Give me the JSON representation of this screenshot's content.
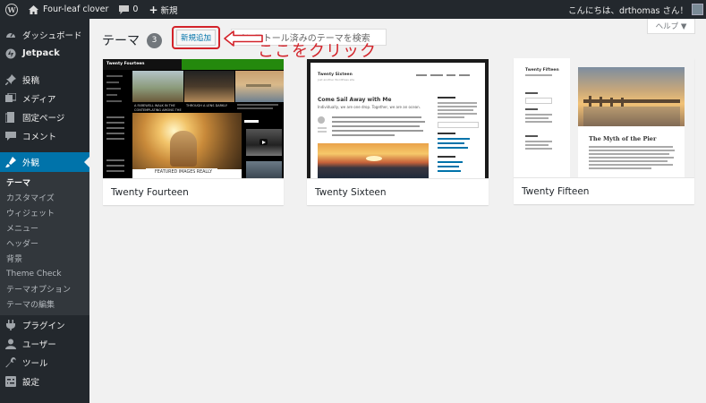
{
  "admin_bar": {
    "site_name": "Four-leaf clover",
    "comment_count": "0",
    "new_label": "新規",
    "greeting": "こんにちは、drthomas さん！"
  },
  "sidebar": {
    "items": [
      {
        "label": "ダッシュボード",
        "icon": "dashboard-icon"
      },
      {
        "label": "Jetpack",
        "icon": "jetpack-icon"
      },
      {
        "label": "投稿",
        "icon": "pin-icon"
      },
      {
        "label": "メディア",
        "icon": "media-icon"
      },
      {
        "label": "固定ページ",
        "icon": "page-icon"
      },
      {
        "label": "コメント",
        "icon": "comment-icon"
      },
      {
        "label": "外観",
        "icon": "appearance-icon"
      },
      {
        "label": "プラグイン",
        "icon": "plugin-icon"
      },
      {
        "label": "ユーザー",
        "icon": "user-icon"
      },
      {
        "label": "ツール",
        "icon": "tools-icon"
      },
      {
        "label": "設定",
        "icon": "settings-icon"
      }
    ],
    "submenu": [
      "テーマ",
      "カスタマイズ",
      "ウィジェット",
      "メニュー",
      "ヘッダー",
      "背景",
      "Theme Check",
      "テーマオプション",
      "テーマの編集"
    ]
  },
  "header": {
    "title": "テーマ",
    "count": "3",
    "add_new": "新規追加",
    "search_placeholder": "インストール済みのテーマを検索",
    "help": "ヘルプ ▼"
  },
  "annotation": "ここをクリック",
  "themes": [
    {
      "name": "Twenty Fourteen",
      "preview": {
        "site_title": "Twenty Fourteen",
        "post1": "A FAREWELL WALK IN THE CONTEMPLATING AMONG THE",
        "post2": "THROUGH A LENS DARKLY",
        "post3": "FEATURED IMAGES REALLY"
      }
    },
    {
      "name": "Twenty Sixteen",
      "preview": {
        "site_title": "Twenty Sixteen",
        "tagline": "Just another WordPress site",
        "post_title": "Come Sail Away with Me",
        "intro": "Individually, we are one drop. Together, we are an ocean."
      }
    },
    {
      "name": "Twenty Fifteen",
      "preview": {
        "site_title": "Twenty Fifteen",
        "post_title": "The Myth of the Pier"
      }
    }
  ],
  "colors": {
    "admin_dark": "#23282d",
    "accent": "#0073aa",
    "annotation_red": "#d3232a",
    "background": "#f1f1f1"
  }
}
